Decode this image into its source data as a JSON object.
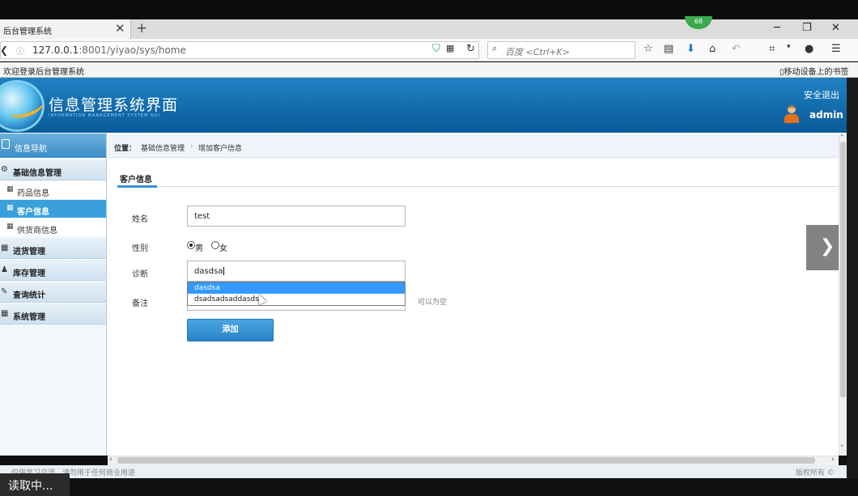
{
  "browser": {
    "tab_title": "后台管理系统",
    "tab_close": "✕",
    "new_tab": "+",
    "badge": "68",
    "window_min": "─",
    "window_restore": "❐",
    "window_close": "✕",
    "url_host": "127.0.0.1",
    "url_rest": ":8001/yiyao/sys/home",
    "search_placeholder": "百度 <Ctrl+K>",
    "bookmark_left": "欢迎登录后台管理系统",
    "bookmark_right": "▯移动设备上的书签"
  },
  "header": {
    "title": "信息管理系统界面",
    "subtitle": "INFORMATION MANAGEMENT SYSTEM GUI",
    "logout": "安全退出",
    "username": "admin"
  },
  "sidebar": {
    "nav_title": "信息导航",
    "groups": [
      {
        "label": "基础信息管理",
        "icon": "gears-icon",
        "glyph": "⚙"
      },
      {
        "label": "进货管理",
        "icon": "calendar-icon",
        "glyph": "▦"
      },
      {
        "label": "库存管理",
        "icon": "users-icon",
        "glyph": "♟"
      },
      {
        "label": "查询统计",
        "icon": "edit-icon",
        "glyph": "✎"
      },
      {
        "label": "系统管理",
        "icon": "calendar-icon",
        "glyph": "▦"
      }
    ],
    "subitems": [
      {
        "label": "药品信息",
        "glyph": "▦"
      },
      {
        "label": "客户信息",
        "glyph": "▦",
        "active": true
      },
      {
        "label": "供货商信息",
        "glyph": "▦"
      }
    ]
  },
  "breadcrumb": {
    "label": "位置：",
    "items": [
      "基础信息管理",
      "增加客户信息"
    ],
    "separator": "›"
  },
  "form": {
    "tab_label": "客户信息",
    "name_label": "姓名",
    "name_value": "test",
    "gender_label": "性别",
    "gender_options": [
      "男",
      "女"
    ],
    "gender_selected": "男",
    "diagnosis_label": "诊断",
    "diagnosis_value": "dasdsa",
    "remark_label": "备注",
    "remark_hint": "可以为空",
    "suggestions": [
      "dasdsa",
      "dsadsadsaddasds"
    ],
    "submit_label": "添加"
  },
  "footer": {
    "left": "仅供学习交流，请勿用于任何商业用途",
    "right": "版权所有 ©"
  },
  "status": {
    "text": "读取中..."
  }
}
